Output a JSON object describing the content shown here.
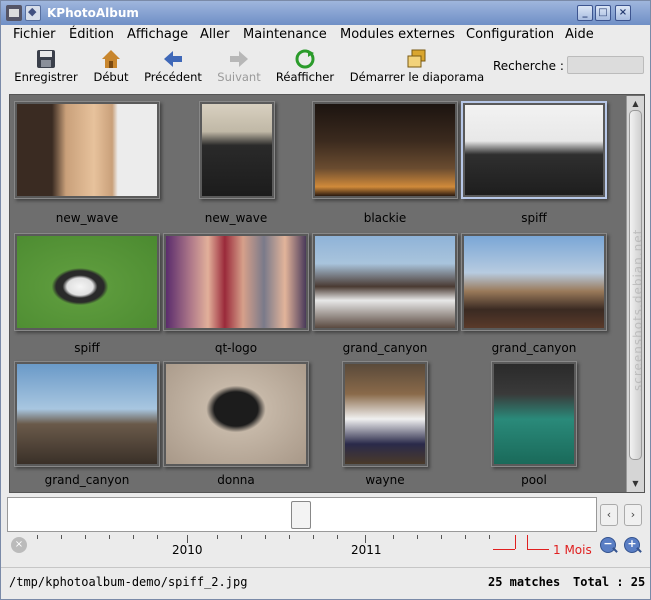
{
  "window": {
    "title": "KPhotoAlbum"
  },
  "menu": [
    "Fichier",
    "Édition",
    "Affichage",
    "Aller",
    "Maintenance",
    "Modules externes",
    "Configuration",
    "Aide"
  ],
  "toolbar": {
    "save": "Enregistrer",
    "start": "Début",
    "previous": "Précédent",
    "next": "Suivant",
    "refresh": "Réafficher",
    "slideshow": "Démarrer le diaporama",
    "search_label": "Recherche :"
  },
  "thumbnails": [
    {
      "caption": "new_wave"
    },
    {
      "caption": "new_wave"
    },
    {
      "caption": "blackie"
    },
    {
      "caption": "spiff"
    },
    {
      "caption": "spiff"
    },
    {
      "caption": "qt-logo"
    },
    {
      "caption": "grand_canyon"
    },
    {
      "caption": "grand_canyon"
    },
    {
      "caption": "grand_canyon"
    },
    {
      "caption": "donna"
    },
    {
      "caption": "wayne"
    },
    {
      "caption": "pool"
    }
  ],
  "timeline": {
    "years": [
      "2010",
      "2011"
    ],
    "unit": "1 Mois"
  },
  "status": {
    "path": "/tmp/kphotoalbum-demo/spiff_2.jpg",
    "matches": "25 matches",
    "total": "Total : 25"
  },
  "watermark": "screenshots.debian.net"
}
